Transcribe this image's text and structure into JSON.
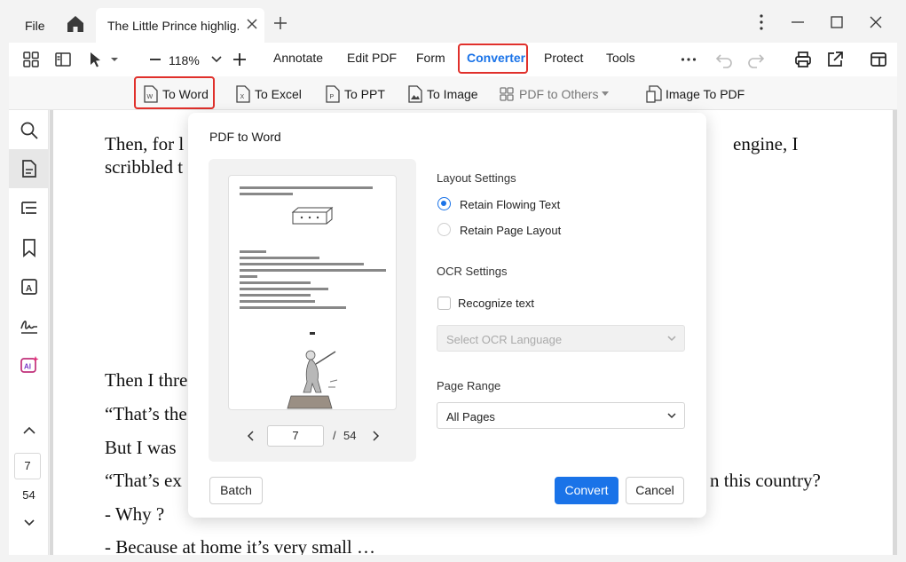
{
  "titlebar": {
    "file_label": "File",
    "tab_title": "The Little Prince highlig..."
  },
  "toolbar": {
    "zoom": "118%",
    "menu": [
      "Annotate",
      "Edit PDF",
      "Form",
      "Converter",
      "Protect",
      "Tools"
    ],
    "active_menu": "Converter"
  },
  "converter": {
    "to_word": "To Word",
    "to_excel": "To Excel",
    "to_ppt": "To PPT",
    "to_image": "To Image",
    "pdf_to_others": "PDF to Others",
    "image_to_pdf": "Image To PDF"
  },
  "sidebar": {
    "current_page": "7",
    "total_pages": "54"
  },
  "document": {
    "lines": [
      "Then, for l",
      "engine, I",
      "scribbled t",
      "Then I thre",
      "“That’s the",
      "But I was ",
      "“That’s ex",
      "n this country?",
      "- Why ?",
      "- Because at home it’s very small …"
    ]
  },
  "dialog": {
    "title": "PDF to Word",
    "layout_settings": "Layout Settings",
    "retain_flowing": "Retain Flowing Text",
    "retain_page": "Retain Page Layout",
    "ocr_settings": "OCR Settings",
    "recognize_text": "Recognize text",
    "ocr_language_placeholder": "Select OCR Language",
    "page_range_label": "Page Range",
    "page_range_value": "All Pages",
    "preview_page": "7",
    "preview_sep": "/",
    "preview_total": "54",
    "batch": "Batch",
    "convert": "Convert",
    "cancel": "Cancel"
  },
  "colors": {
    "accent": "#1a73e8",
    "highlight_box": "#e0302b"
  }
}
